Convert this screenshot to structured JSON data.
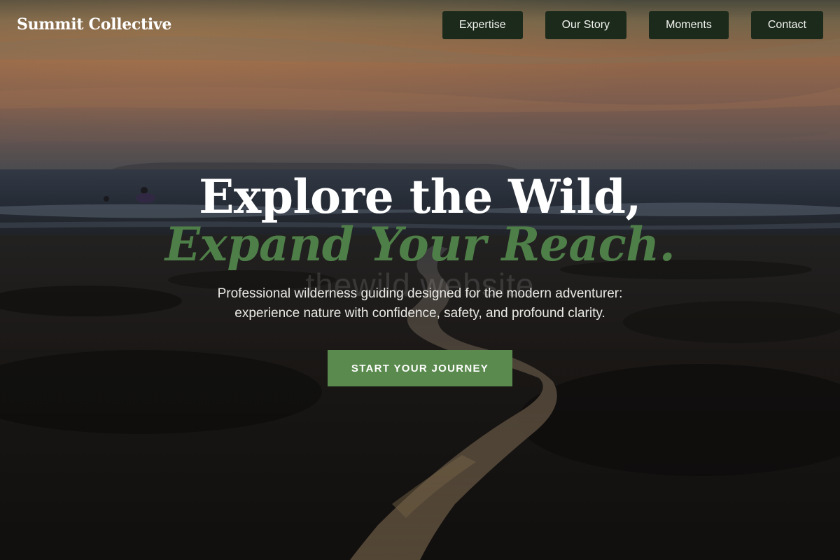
{
  "header": {
    "brand": "Summit Collective",
    "nav": [
      {
        "label": "Expertise"
      },
      {
        "label": "Our Story"
      },
      {
        "label": "Moments"
      },
      {
        "label": "Contact"
      }
    ]
  },
  "hero": {
    "headline_line1": "Explore the Wild,",
    "headline_line2": "Expand Your Reach.",
    "watermark": "thewild website",
    "subtitle_line1": "Professional wilderness guiding designed for the modern adventurer:",
    "subtitle_line2": "experience nature with confidence, safety, and profound clarity.",
    "cta_label": "START YOUR JOURNEY",
    "background_image": "sunset-beach-tidal-stream"
  },
  "colors": {
    "nav_button_bg": "#1b2a1b",
    "accent_green": "#4f7f48",
    "cta_bg": "#5a8a4e",
    "text_light": "#ffffff"
  }
}
